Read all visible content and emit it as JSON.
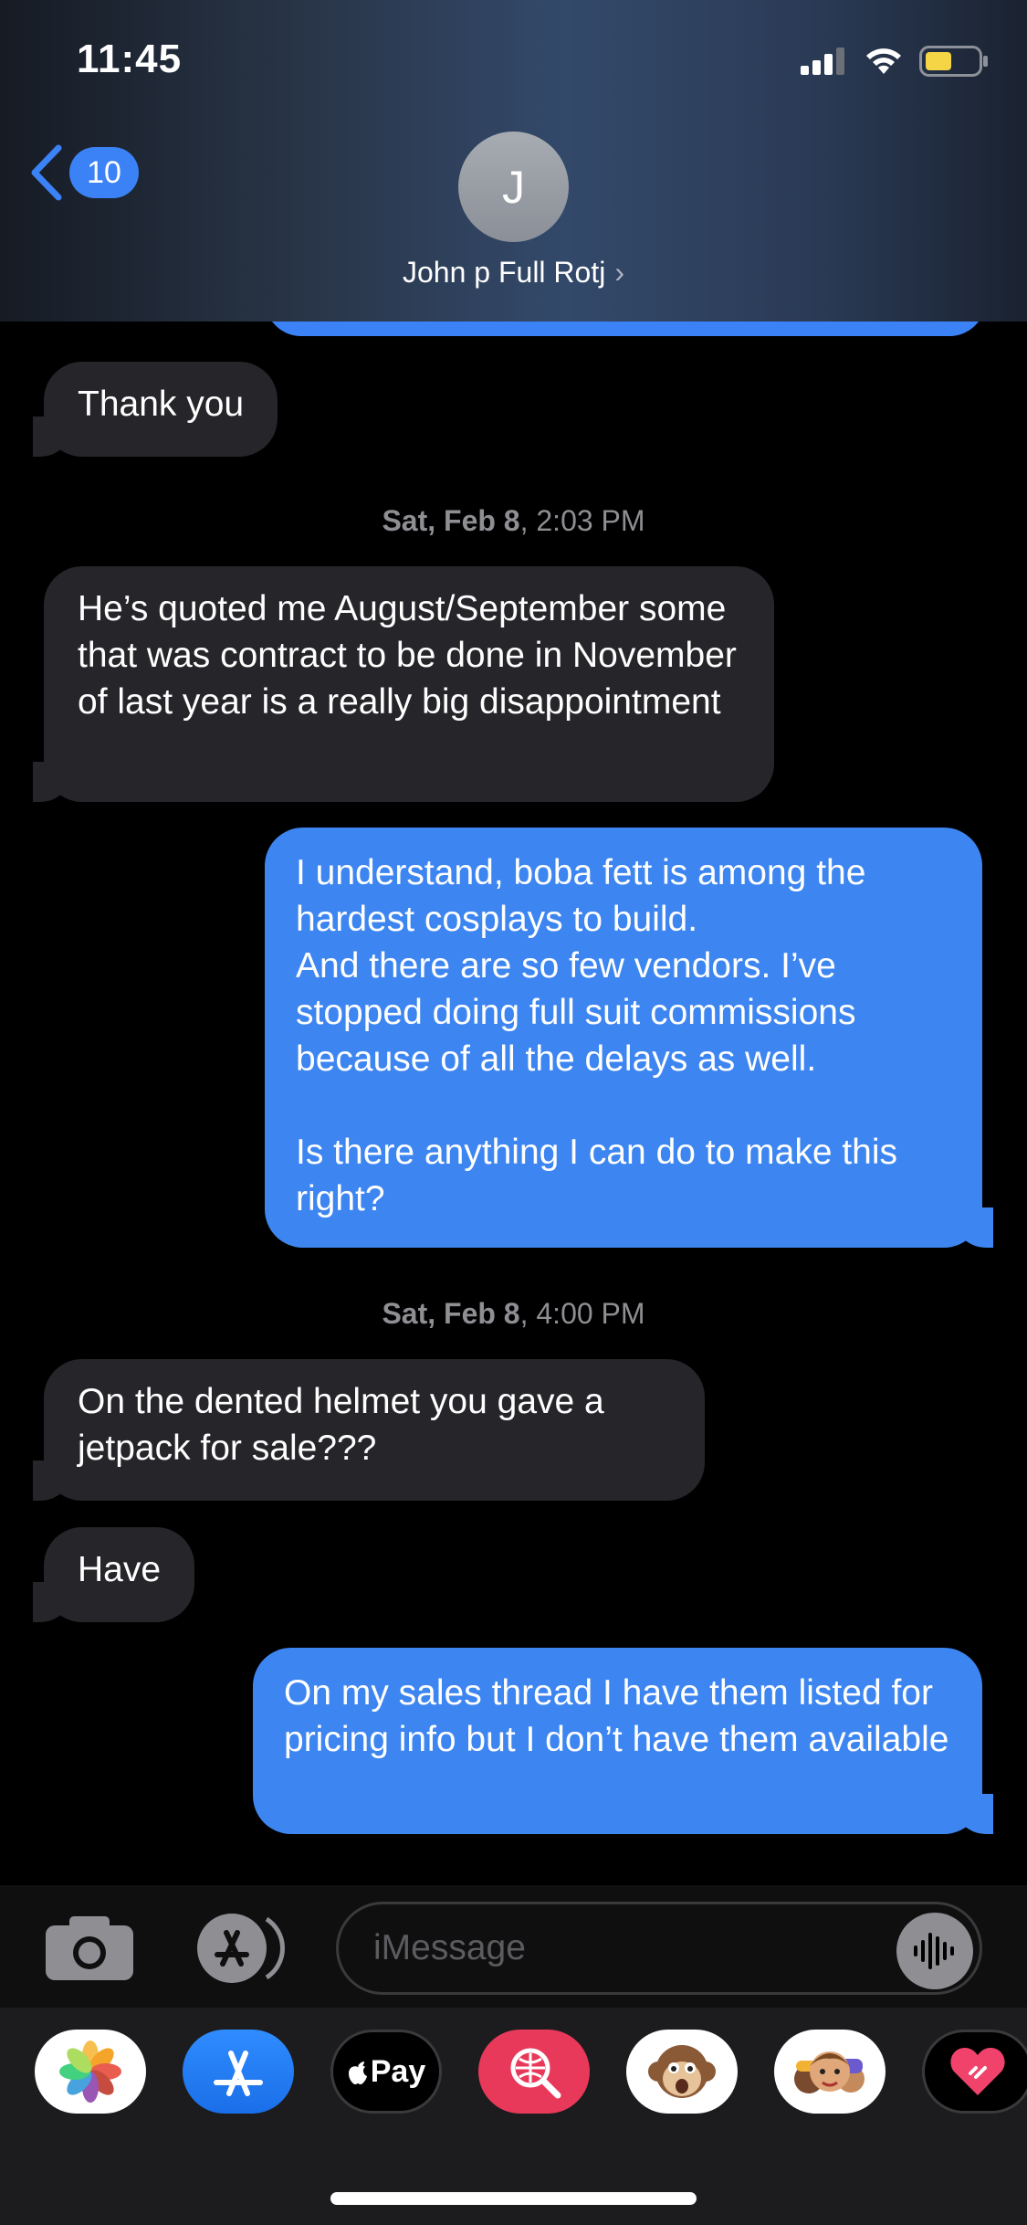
{
  "status_bar": {
    "time": "11:45"
  },
  "nav": {
    "back_count": "10",
    "avatar_initial": "J",
    "contact_name": "John p Full Rotj"
  },
  "messages": {
    "m1": "Thank you",
    "ts1_day": "Sat, Feb 8",
    "ts1_time": ", 2:03 PM",
    "m2": "He’s quoted me August/September some that was contract to be done in November of last year is a really big disappointment",
    "m3": "I understand, boba fett is among the hardest cosplays to build.\nAnd there are so few vendors. I’ve stopped doing full suit commissions because of all the delays as well.\n\nIs there anything I can do to make this right?",
    "ts2_day": "Sat, Feb 8",
    "ts2_time": ", 4:00 PM",
    "m4": "On the dented helmet you gave a jetpack for sale???",
    "m5": "Have",
    "m6": "On my sales thread I have them listed for pricing info but I don’t have them available"
  },
  "composer": {
    "placeholder": "iMessage"
  },
  "app_drawer": {
    "apps": [
      "photos-icon",
      "app-store-icon",
      "apple-pay-icon",
      "image-search-icon",
      "monkey-memoji-icon",
      "memoji-icon",
      "digital-touch-icon"
    ],
    "apple_pay_label": "Pay"
  },
  "colors": {
    "sent_bubble": "#3d85f0",
    "received_bubble": "#26262a",
    "accent": "#3b82f6"
  }
}
